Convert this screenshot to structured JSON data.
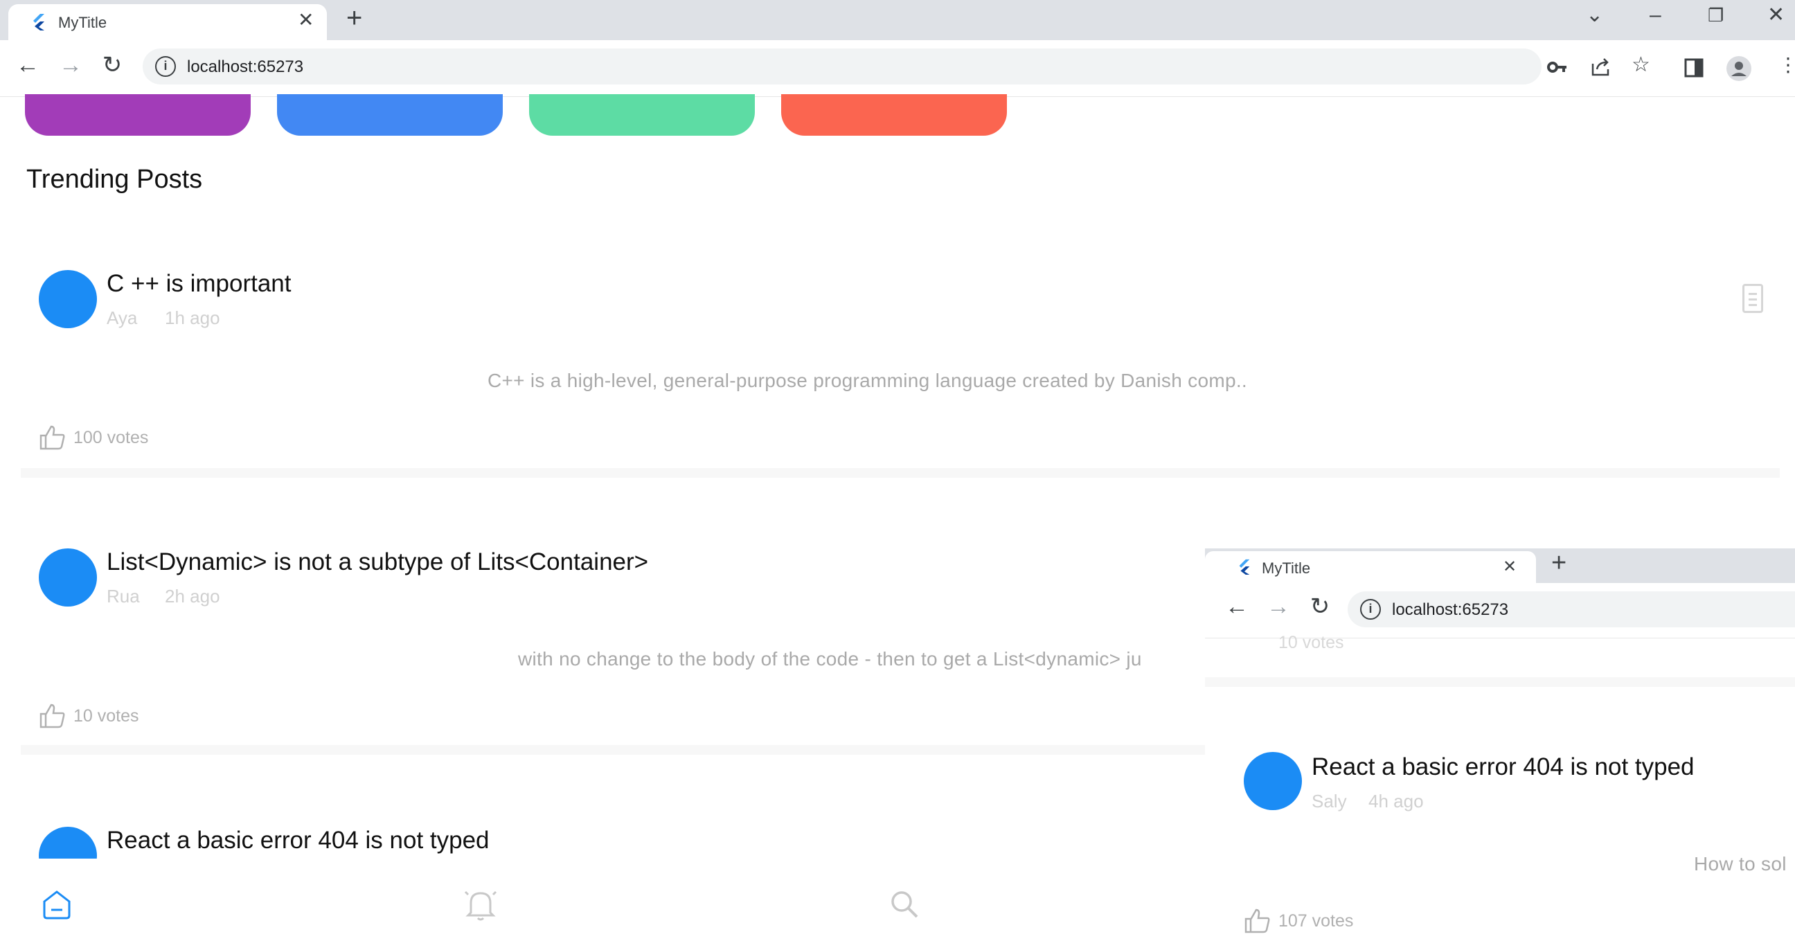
{
  "browser": {
    "tab_title": "MyTitle",
    "tab_close": "✕",
    "new_tab": "+",
    "url": "localhost:65273",
    "window_controls": {
      "tabs_menu": "⌄",
      "minimize": "–",
      "restore": "❐",
      "close": "✕"
    },
    "nav": {
      "back": "←",
      "forward": "→",
      "reload": "↻"
    },
    "toolbar_icons": [
      "key-icon",
      "share-icon",
      "star-icon",
      "sidebar-icon",
      "profile-icon",
      "menu-icon"
    ]
  },
  "categories": [
    {
      "color": "#a23cb8"
    },
    {
      "color": "#4288f3"
    },
    {
      "color": "#5ddca4"
    },
    {
      "color": "#fb6550"
    }
  ],
  "section_title": "Trending Posts",
  "posts": [
    {
      "title": "C ++ is important",
      "author": "Aya",
      "time": "1h ago",
      "excerpt": "C++ is a high-level, general-purpose programming language created by Danish comp..",
      "votes": "100 votes"
    },
    {
      "title": "List<Dynamic> is not a subtype of Lits<Container>",
      "author": "Rua",
      "time": "2h ago",
      "excerpt": "with no change to the body of the code - then to get a List<dynamic> ju",
      "votes": "10 votes"
    },
    {
      "title": "React a basic error 404 is not typed"
    }
  ],
  "bottom_nav": [
    "home-icon",
    "bell-icon",
    "search-icon"
  ],
  "overlay": {
    "tab_title": "MyTitle",
    "tab_close": "✕",
    "new_tab": "+",
    "url": "localhost:65273",
    "nav": {
      "back": "←",
      "forward": "→",
      "reload": "↻"
    },
    "partial_votes": "10 votes",
    "post": {
      "title": "React a basic error 404 is not typed",
      "author": "Saly",
      "time": "4h ago",
      "excerpt": "How to sol",
      "votes": "107 votes"
    }
  },
  "colors": {
    "avatar": "#1b8cf5",
    "chrome": "#dee1e6",
    "omnibox": "#f1f3f4"
  }
}
